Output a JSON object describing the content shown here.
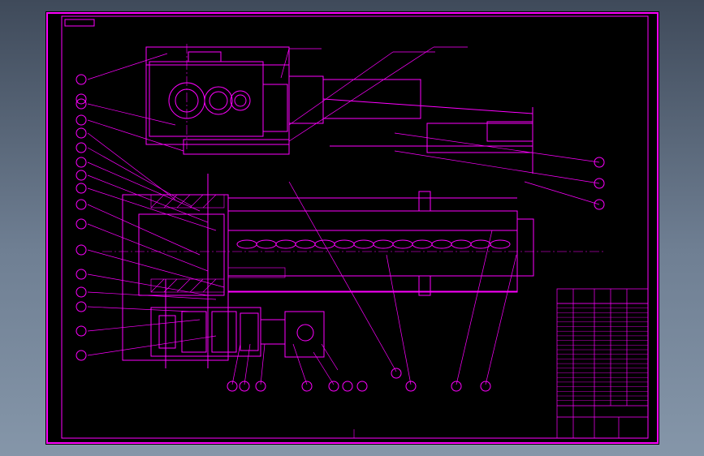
{
  "drawing": {
    "title_stamp": "",
    "stroke_color": "#ff00ff",
    "background": "#000000",
    "frame_color": "#ff00ff"
  },
  "balloons_left": [
    "",
    "",
    "",
    "",
    "",
    "",
    "",
    "",
    "",
    "",
    "",
    "",
    "",
    "",
    "",
    "",
    ""
  ],
  "balloons_right": [
    "",
    "",
    ""
  ],
  "balloons_bottom": [
    "",
    "",
    "",
    "",
    "",
    "",
    "",
    "",
    "",
    "",
    ""
  ],
  "parts_list_rows": 22,
  "notes": []
}
